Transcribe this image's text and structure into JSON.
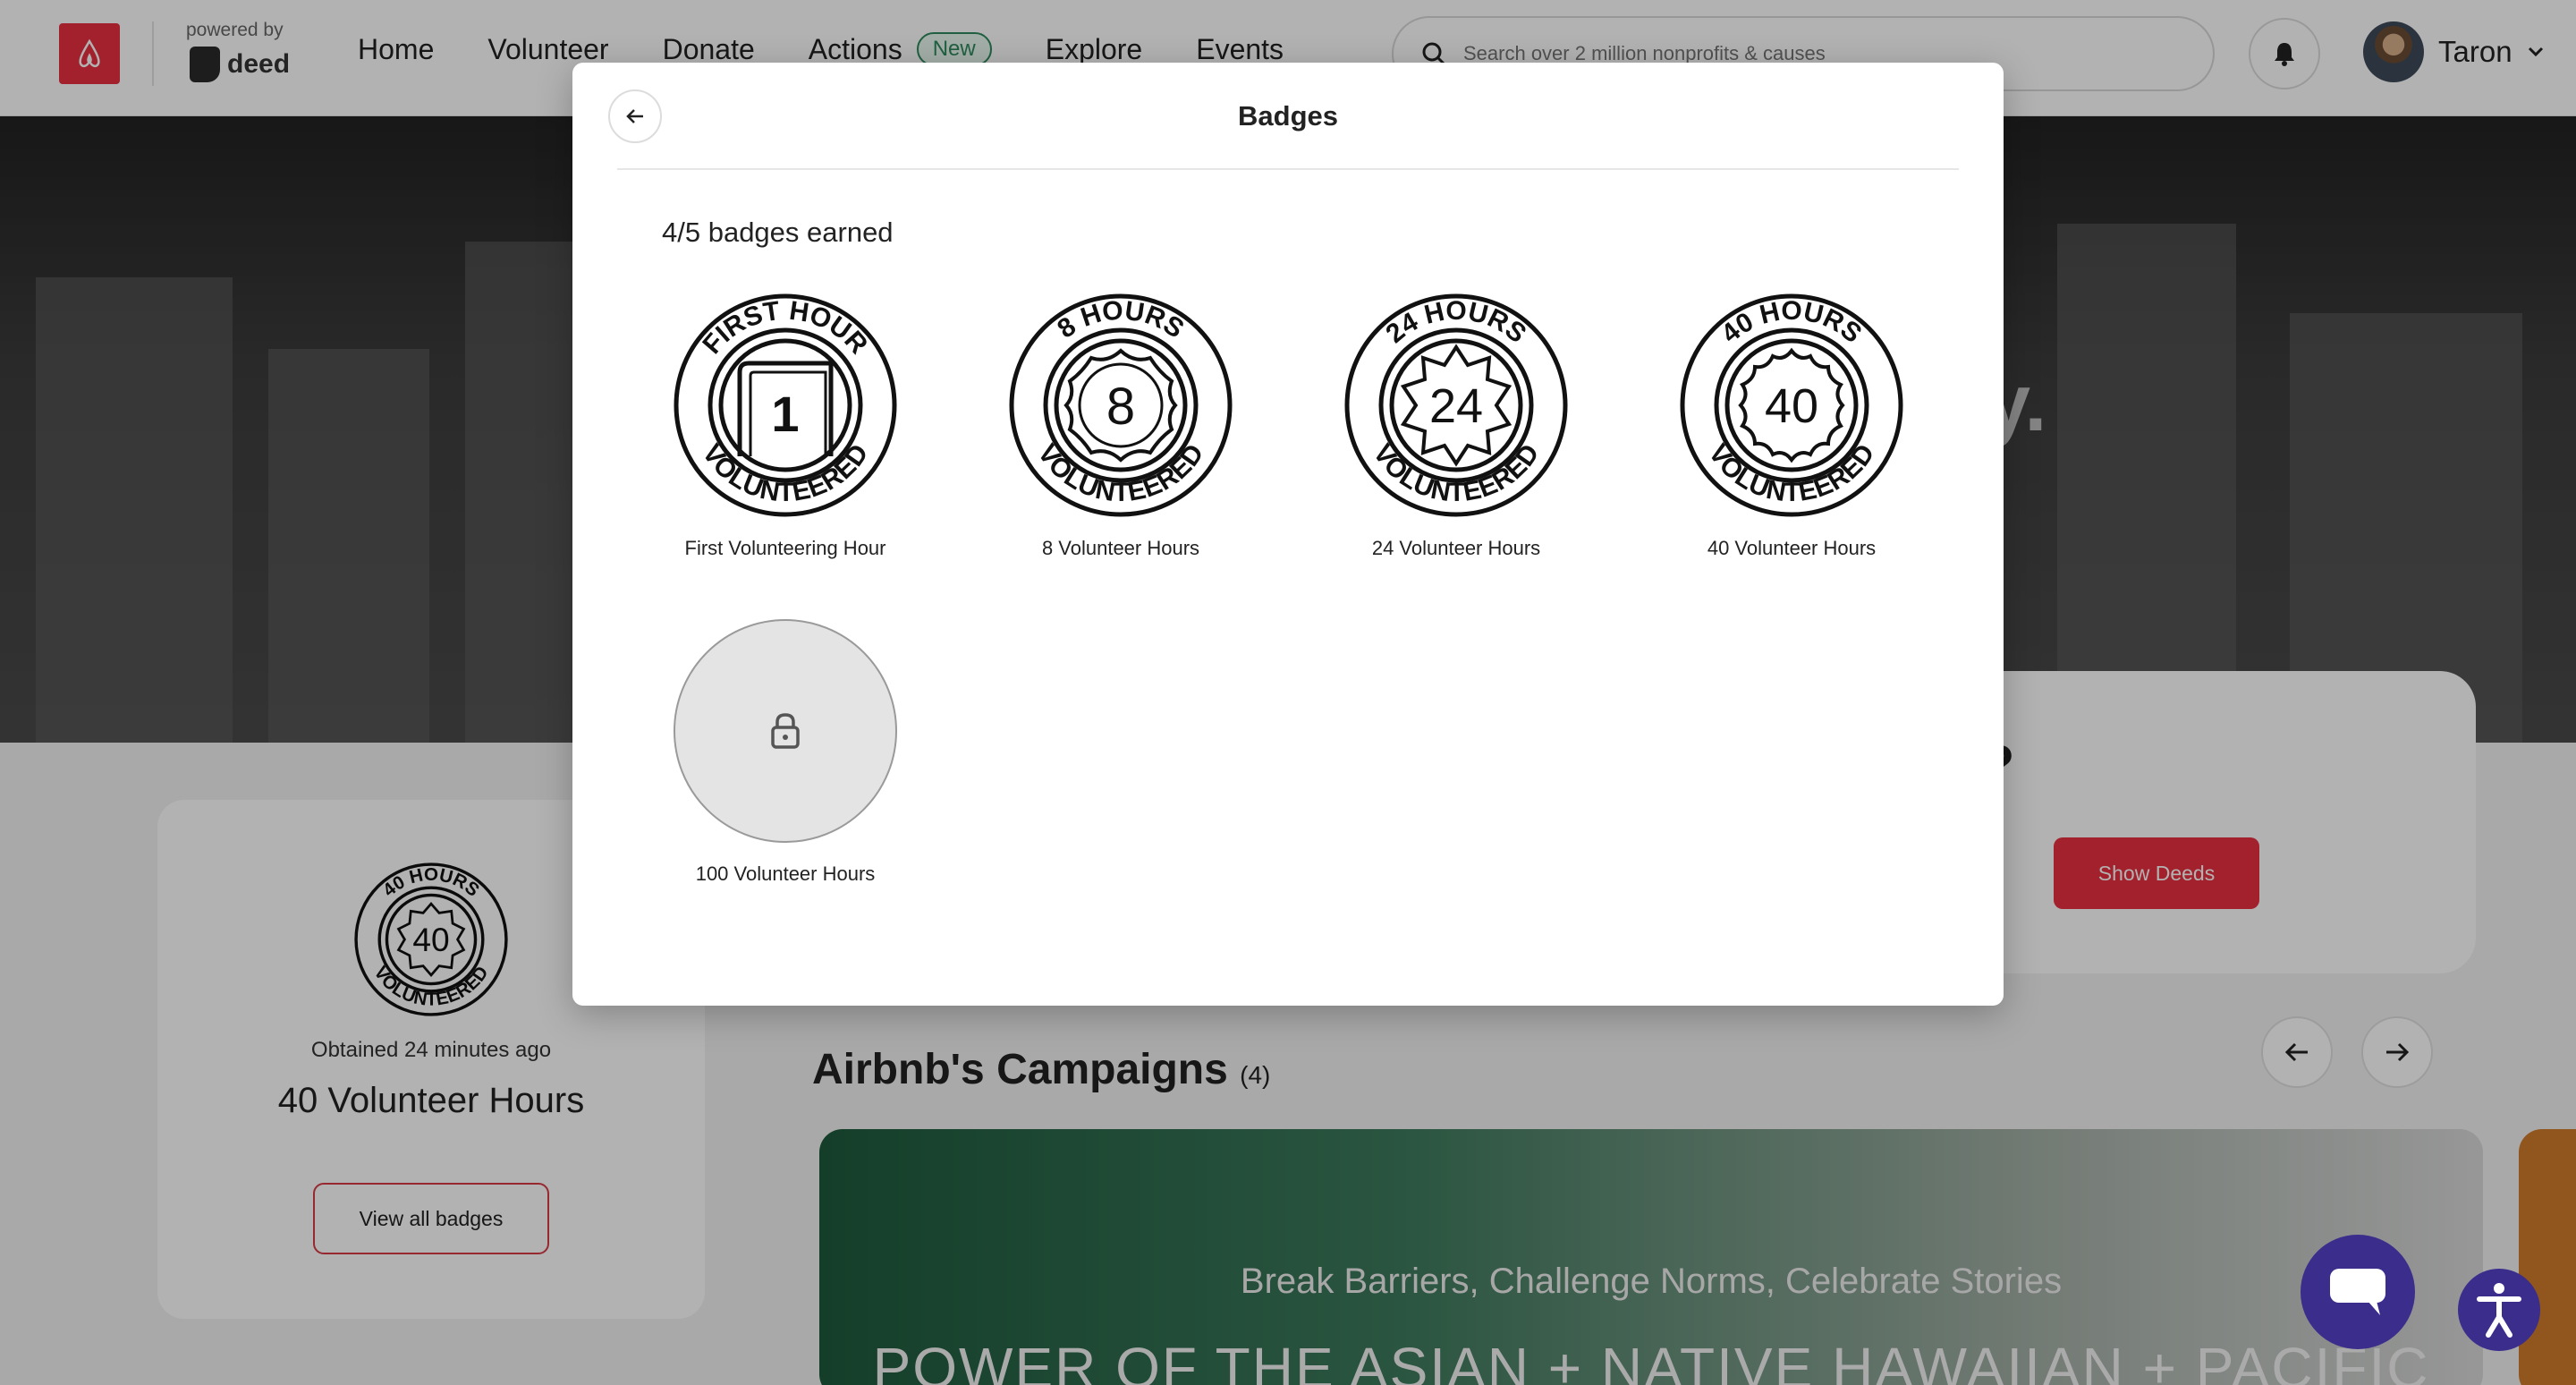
{
  "header": {
    "powered_by": "powered by",
    "deed_label": "deed",
    "nav": [
      "Home",
      "Volunteer",
      "Donate",
      "Actions",
      "Explore",
      "Events"
    ],
    "new_badge": "New",
    "search_placeholder": "Search over 2 million nonprofits & causes",
    "user_name": "Taron"
  },
  "hero": {
    "partial_text": "y."
  },
  "question": {
    "partial_text": "e?",
    "show_deeds_label": "Show Deeds"
  },
  "badge_card": {
    "obtained": "Obtained 24 minutes ago",
    "title": "40 Volunteer Hours",
    "view_all_label": "View all badges"
  },
  "campaigns": {
    "title": "Airbnb's Campaigns",
    "count": "(4)",
    "banner_subtitle": "Break Barriers, Challenge Norms, Celebrate Stories",
    "banner_title": "POWER OF THE ASIAN + NATIVE HAWAIIAN + PACIFIC"
  },
  "modal": {
    "title": "Badges",
    "earned": "4/5 badges earned",
    "badges": [
      {
        "label": "First Volunteering Hour",
        "top_text": "FIRST HOUR",
        "center": "1",
        "bottom_text": "VOLUNTEERED",
        "earned": true
      },
      {
        "label": "8 Volunteer Hours",
        "top_text": "8 HOURS",
        "center": "8",
        "bottom_text": "VOLUNTEERED",
        "earned": true
      },
      {
        "label": "24 Volunteer Hours",
        "top_text": "24 HOURS",
        "center": "24",
        "bottom_text": "VOLUNTEERED",
        "earned": true
      },
      {
        "label": "40 Volunteer Hours",
        "top_text": "40 HOURS",
        "center": "40",
        "bottom_text": "VOLUNTEERED",
        "earned": true
      },
      {
        "label": "100 Volunteer Hours",
        "earned": false
      }
    ]
  },
  "colors": {
    "brand": "#e8303f",
    "accent_purple": "#3a2d8c",
    "new_green": "#2e8a5e"
  },
  "icons": [
    "airbnb-logo-icon",
    "search-icon",
    "bell-icon",
    "chevron-down-icon",
    "arrow-left-icon",
    "arrow-right-icon",
    "lock-icon",
    "chat-icon",
    "accessibility-icon"
  ]
}
